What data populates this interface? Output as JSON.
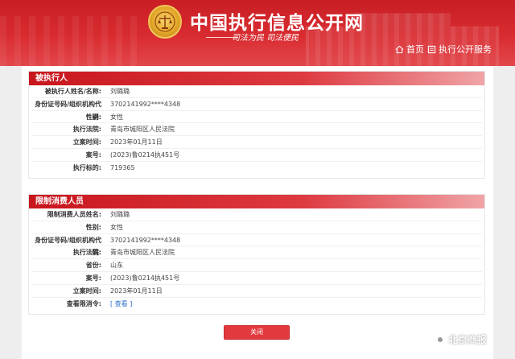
{
  "header": {
    "site_title": "中国执行信息公开网",
    "slogan": "司法为民  司法便民",
    "nav_home": "首页",
    "nav_service": "执行公开服务"
  },
  "panel_executed": {
    "title": "被执行人",
    "rows": [
      {
        "label": "被执行人姓名/名称:",
        "value": "刘璐璐"
      },
      {
        "label": "身份证号码/组织机构代码:",
        "value": "3702141992****4348"
      },
      {
        "label": "性别:",
        "value": "女性"
      },
      {
        "label": "执行法院:",
        "value": "青岛市城阳区人民法院"
      },
      {
        "label": "立案时间:",
        "value": "2023年01月11日"
      },
      {
        "label": "案号:",
        "value": "(2023)鲁0214执451号"
      },
      {
        "label": "执行标的:",
        "value": "719365"
      }
    ]
  },
  "panel_restricted": {
    "title": "限制消费人员",
    "rows": [
      {
        "label": "限制消费人员姓名:",
        "value": "刘璐璐"
      },
      {
        "label": "性别:",
        "value": "女性"
      },
      {
        "label": "身份证号码/组织机构代码:",
        "value": "3702141992****4348"
      },
      {
        "label": "执行法院:",
        "value": "青岛市城阳区人民法院"
      },
      {
        "label": "省份:",
        "value": "山东"
      },
      {
        "label": "案号:",
        "value": "(2023)鲁0214执451号"
      },
      {
        "label": "立案时间:",
        "value": "2023年01月11日"
      },
      {
        "label": "查看限消令:",
        "value": "[ 查看 ]"
      }
    ]
  },
  "close_button": "关闭",
  "watermark": "北京商报",
  "colors": {
    "brand_red": "#c8161d",
    "link_blue": "#2a6fc9"
  }
}
